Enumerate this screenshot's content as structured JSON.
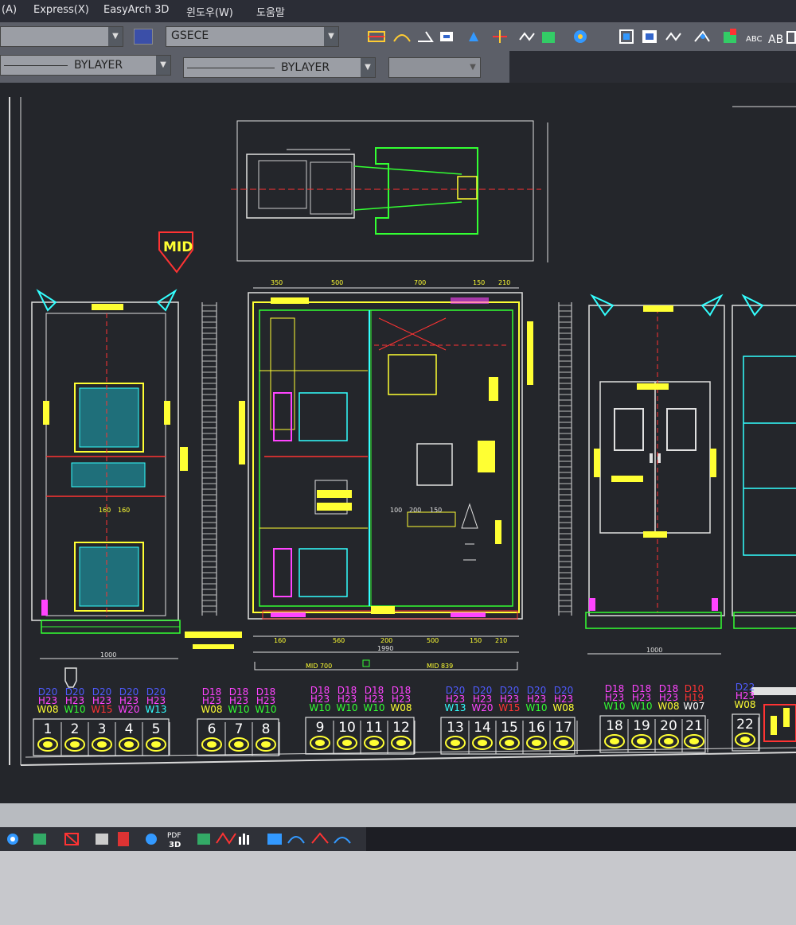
{
  "menu": {
    "item_a": "(A)",
    "express": "Express(X)",
    "easyarch": "EasyArch 3D",
    "window": "윈도우(W)",
    "help": "도움말"
  },
  "toolbar": {
    "textstyle_value": "GSECE",
    "linetype_value": "BYLAYER",
    "lineweight_value": "BYLAYER"
  },
  "drawing": {
    "mid_label": "MID",
    "top_dims": [
      "350",
      "500",
      "700",
      "150",
      "210"
    ],
    "bottom_dims": [
      "160",
      "560",
      "200",
      "500",
      "150",
      "210"
    ],
    "bottom_total": "1990",
    "mid_left": "MID 700",
    "mid_right": "MID 839",
    "left_width": "1000",
    "right_width": "1000",
    "mid_dims": [
      "100",
      "200",
      "150"
    ],
    "left_small_dims": [
      "160",
      "160"
    ]
  },
  "legend": [
    {
      "num": "1",
      "d": "D20",
      "h": "H23",
      "w": "W08",
      "dc": "#4f5bff",
      "hc": "#ff44ff",
      "wc": "#ffff33"
    },
    {
      "num": "2",
      "d": "D20",
      "h": "H23",
      "w": "W10",
      "dc": "#4f5bff",
      "hc": "#ff44ff",
      "wc": "#33ff33"
    },
    {
      "num": "3",
      "d": "D20",
      "h": "H23",
      "w": "W15",
      "dc": "#4f5bff",
      "hc": "#ff44ff",
      "wc": "#ff3333"
    },
    {
      "num": "4",
      "d": "D20",
      "h": "H23",
      "w": "W20",
      "dc": "#4f5bff",
      "hc": "#ff44ff",
      "wc": "#ff44ff"
    },
    {
      "num": "5",
      "d": "D20",
      "h": "H23",
      "w": "W13",
      "dc": "#4f5bff",
      "hc": "#ff44ff",
      "wc": "#33ffff"
    },
    {
      "num": "6",
      "d": "D18",
      "h": "H23",
      "w": "W08",
      "dc": "#ff44ff",
      "hc": "#ff44ff",
      "wc": "#ffff33"
    },
    {
      "num": "7",
      "d": "D18",
      "h": "H23",
      "w": "W10",
      "dc": "#ff44ff",
      "hc": "#ff44ff",
      "wc": "#33ff33"
    },
    {
      "num": "8",
      "d": "D18",
      "h": "H23",
      "w": "W10",
      "dc": "#ff44ff",
      "hc": "#ff44ff",
      "wc": "#33ff33"
    },
    {
      "num": "9",
      "d": "D18",
      "h": "H23",
      "w": "W10",
      "dc": "#ff44ff",
      "hc": "#ff44ff",
      "wc": "#33ff33"
    },
    {
      "num": "10",
      "d": "D18",
      "h": "H23",
      "w": "W10",
      "dc": "#ff44ff",
      "hc": "#ff44ff",
      "wc": "#33ff33"
    },
    {
      "num": "11",
      "d": "D18",
      "h": "H23",
      "w": "W10",
      "dc": "#ff44ff",
      "hc": "#ff44ff",
      "wc": "#33ff33"
    },
    {
      "num": "12",
      "d": "D18",
      "h": "H23",
      "w": "W08",
      "dc": "#ff44ff",
      "hc": "#ff44ff",
      "wc": "#ffff33"
    },
    {
      "num": "13",
      "d": "D20",
      "h": "H23",
      "w": "W13",
      "dc": "#4f5bff",
      "hc": "#ff44ff",
      "wc": "#33ffff"
    },
    {
      "num": "14",
      "d": "D20",
      "h": "H23",
      "w": "W20",
      "dc": "#4f5bff",
      "hc": "#ff44ff",
      "wc": "#ff44ff"
    },
    {
      "num": "15",
      "d": "D20",
      "h": "H23",
      "w": "W15",
      "dc": "#4f5bff",
      "hc": "#ff44ff",
      "wc": "#ff3333"
    },
    {
      "num": "16",
      "d": "D20",
      "h": "H23",
      "w": "W10",
      "dc": "#4f5bff",
      "hc": "#ff44ff",
      "wc": "#33ff33"
    },
    {
      "num": "17",
      "d": "D20",
      "h": "H23",
      "w": "W08",
      "dc": "#4f5bff",
      "hc": "#ff44ff",
      "wc": "#ffff33"
    },
    {
      "num": "18",
      "d": "D18",
      "h": "H23",
      "w": "W10",
      "dc": "#ff44ff",
      "hc": "#ff44ff",
      "wc": "#33ff33"
    },
    {
      "num": "19",
      "d": "D18",
      "h": "H23",
      "w": "W10",
      "dc": "#ff44ff",
      "hc": "#ff44ff",
      "wc": "#33ff33"
    },
    {
      "num": "20",
      "d": "D18",
      "h": "H23",
      "w": "W08",
      "dc": "#ff44ff",
      "hc": "#ff44ff",
      "wc": "#ffff33"
    },
    {
      "num": "21",
      "d": "D10",
      "h": "H19",
      "w": "W07",
      "dc": "#ff3333",
      "hc": "#ff3333",
      "wc": "#ffffff"
    },
    {
      "num": "22",
      "d": "D22",
      "h": "H23",
      "w": "W08",
      "dc": "#4f5bff",
      "hc": "#ff44ff",
      "wc": "#ffff33"
    }
  ],
  "bottom_toolbar": {
    "pdf_label": "PDF",
    "three_d_label": "3D"
  },
  "colors": {
    "cad_background": "#24262b",
    "yellow": "#ffff33",
    "cyan": "#33ffff",
    "green": "#33ff33",
    "magenta": "#ff44ff",
    "red": "#ff3333",
    "white": "#e8e8e8"
  }
}
